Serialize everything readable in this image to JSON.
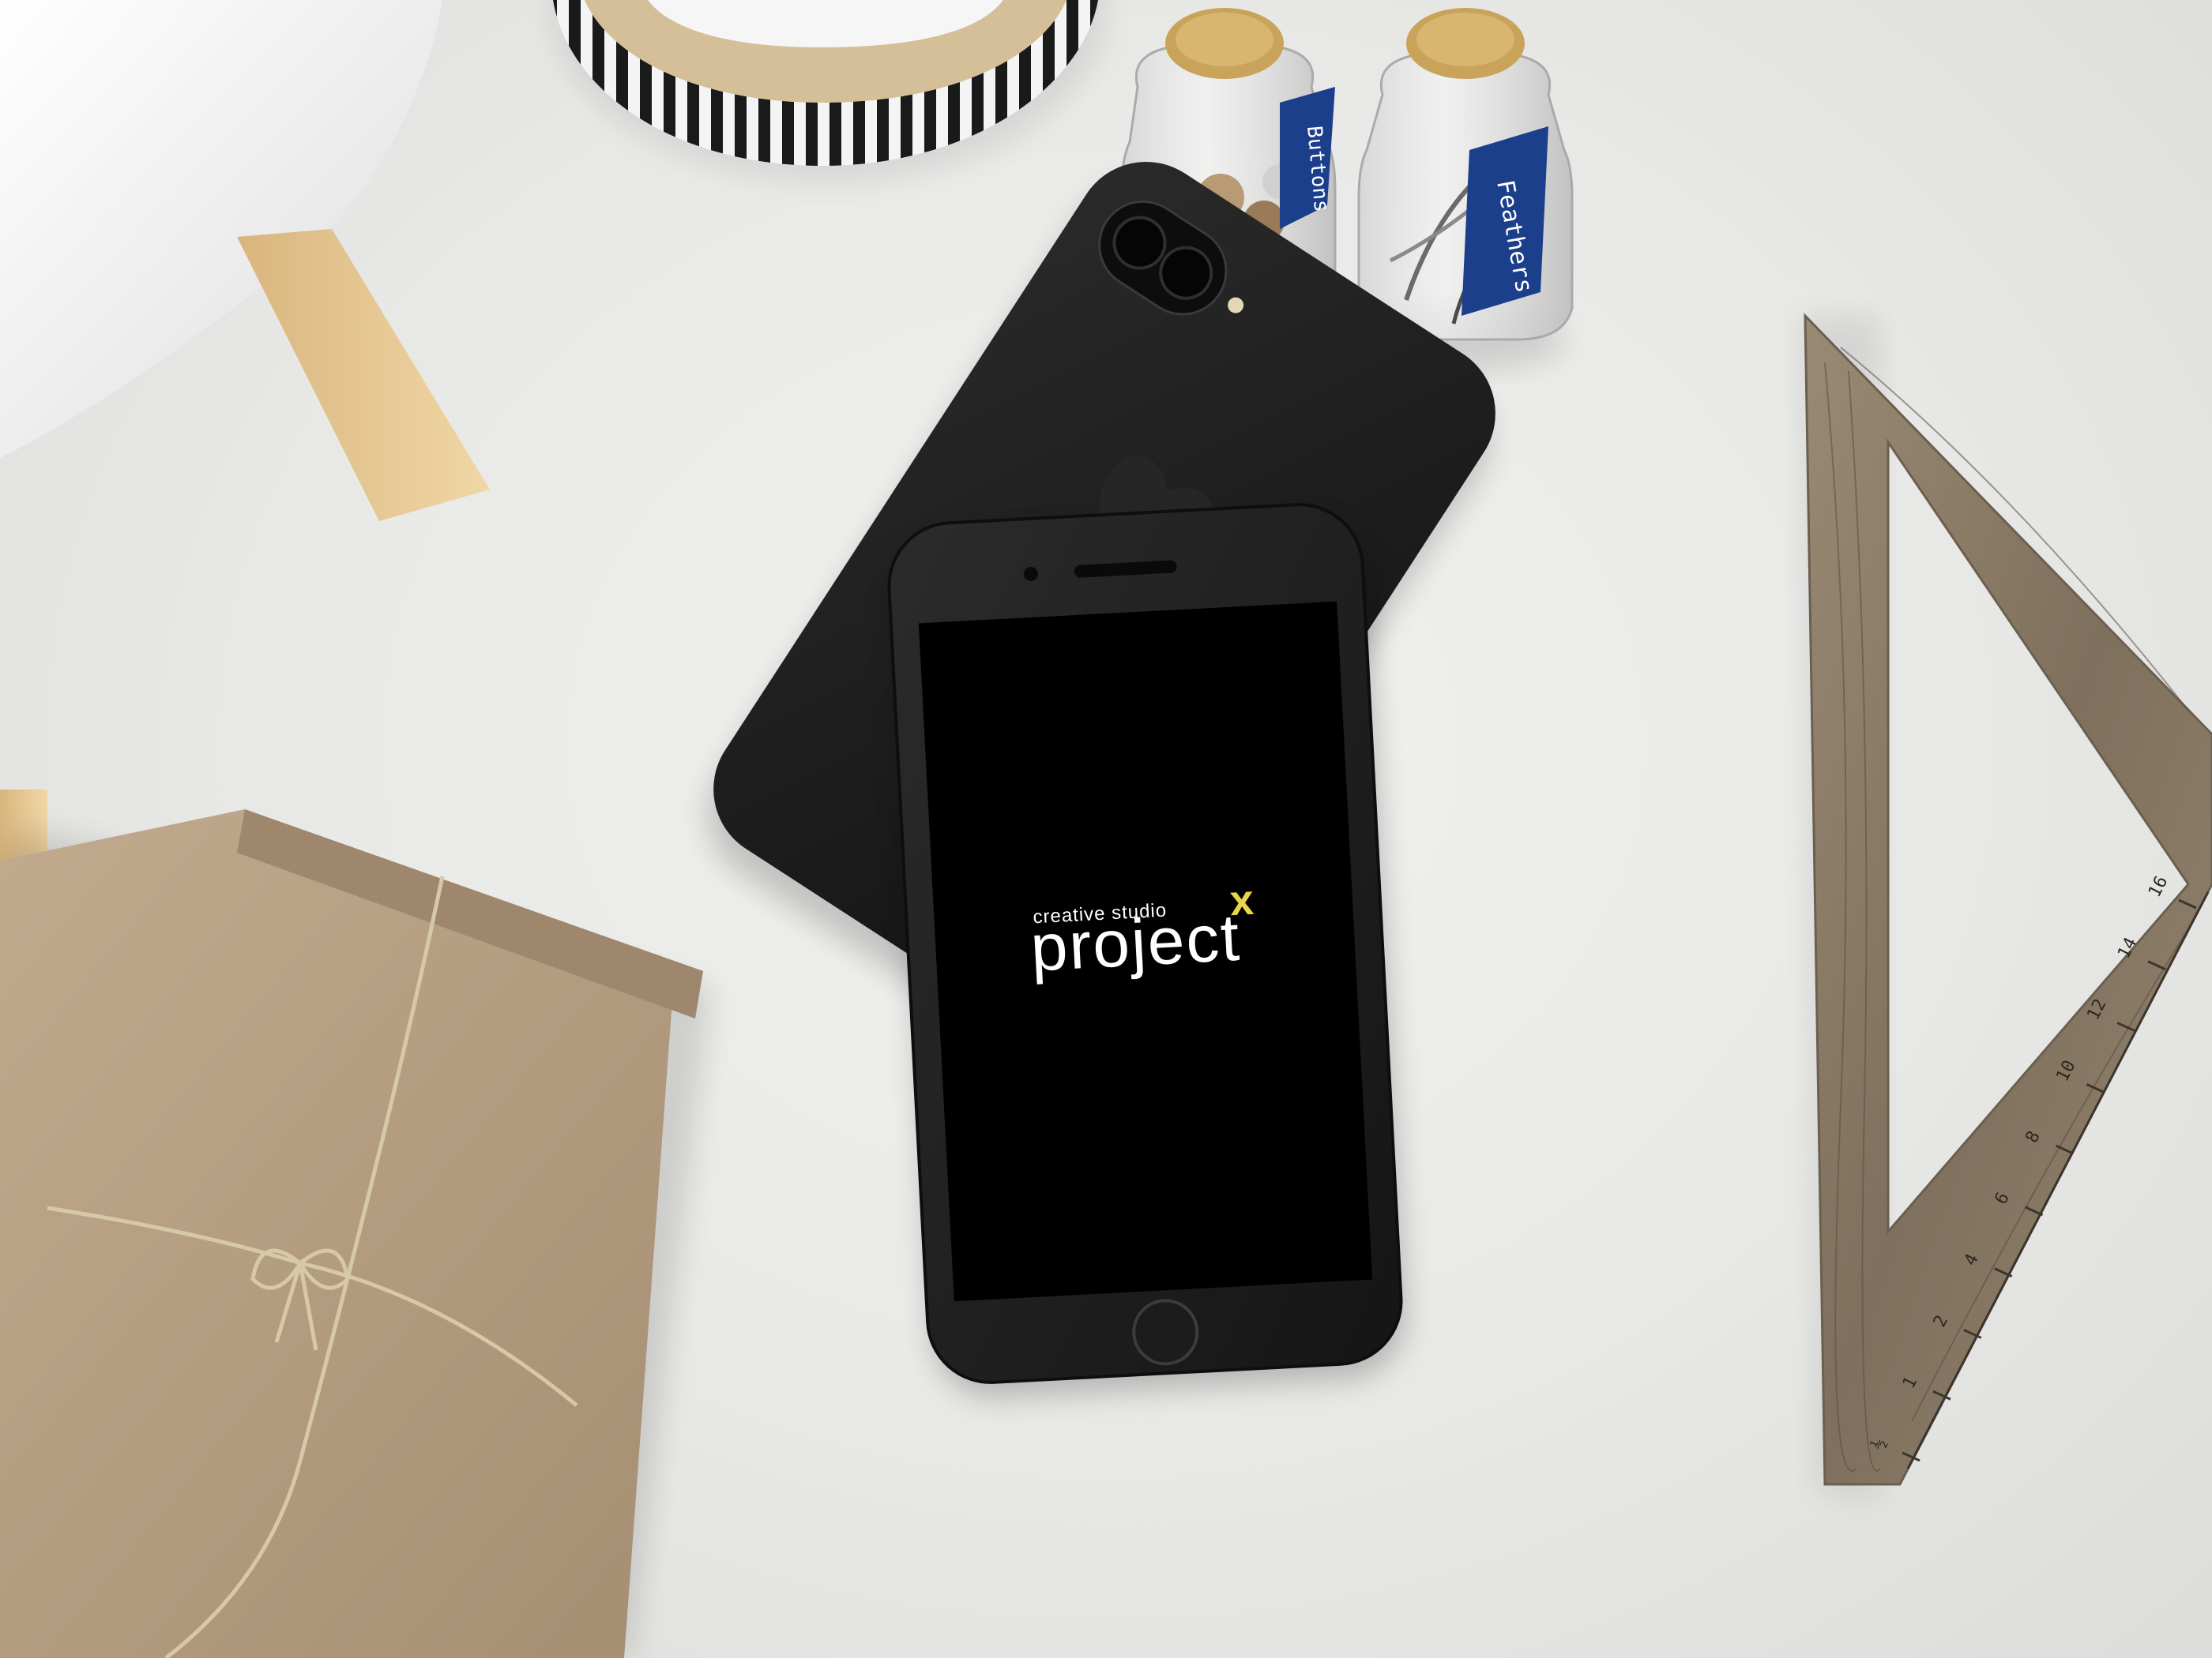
{
  "phone_screen": {
    "tagline": "creative studio",
    "brand": "project",
    "brand_mark": "x",
    "brand_mark_color": "#e8d64a",
    "text_color": "#ffffff",
    "screen_color": "#000000"
  },
  "jar_labels": {
    "left": "Buttons",
    "right": "Feathers"
  },
  "ruler_ticks": [
    "½",
    "1",
    "2",
    "4",
    "6",
    "8",
    "10",
    "12",
    "14",
    "16"
  ],
  "colors": {
    "background": "#e9e9e7",
    "phone_body": "#1b1b1b",
    "kraft_paper": "#b69e83",
    "wood": "#8a7a66",
    "jar_tag": "#1c3f8c",
    "cork": "#c9a35a"
  }
}
